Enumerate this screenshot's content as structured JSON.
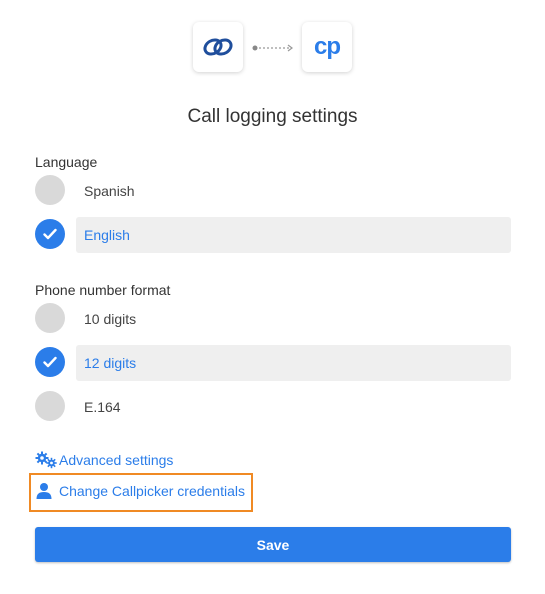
{
  "header": {
    "left_logo_icon": "zoho-link-icon",
    "right_logo_icon": "callpicker-cp-icon",
    "right_logo_text": "cp",
    "accent_color": "#2b7de9"
  },
  "title": "Call logging settings",
  "language": {
    "label": "Language",
    "options": [
      {
        "label": "Spanish",
        "checked": false
      },
      {
        "label": "English",
        "checked": true
      }
    ]
  },
  "phone_format": {
    "label": "Phone number format",
    "options": [
      {
        "label": "10 digits",
        "checked": false
      },
      {
        "label": "12 digits",
        "checked": true
      },
      {
        "label": "E.164",
        "checked": false
      }
    ]
  },
  "links": {
    "advanced": "Advanced settings",
    "credentials": "Change Callpicker credentials"
  },
  "save_label": "Save"
}
